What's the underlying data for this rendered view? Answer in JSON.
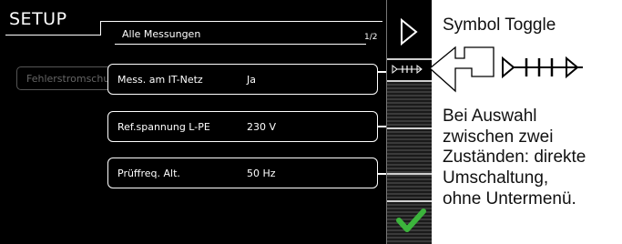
{
  "header": {
    "title": "SETUP",
    "subtitle": "Alle Messungen",
    "page_indicator": "1/2"
  },
  "ghost_tab": {
    "label": "Fehlerstromschutz"
  },
  "parameters": [
    {
      "label": "Mess. am IT-Netz",
      "value": "Ja"
    },
    {
      "label": "Ref.spannung L-PE",
      "value": "230 V"
    },
    {
      "label": "Prüffreq. Alt.",
      "value": "50 Hz"
    }
  ],
  "softkeys": {
    "top_icon": "play-outline-icon",
    "toggle_icon": "toggle-symbol-icon",
    "confirm_icon": "green-checkmark-icon",
    "confirm_color": "#3cb43c"
  },
  "annotation": {
    "title": "Symbol Toggle",
    "lines": [
      "Bei Auswahl",
      "zwischen zwei",
      "Zuständen: direkte",
      "Umschaltung,",
      "ohne Untermenü."
    ]
  }
}
